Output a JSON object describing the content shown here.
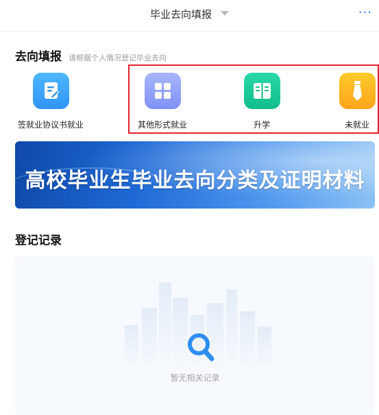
{
  "header": {
    "title": "毕业去向填报",
    "more": "···"
  },
  "section": {
    "title": "去向填报",
    "hint": "请根据个人情况登记毕业去向"
  },
  "categories": [
    {
      "label": "签就业协议书就业",
      "icon": "contract-edit-icon"
    },
    {
      "label": "其他形式就业",
      "icon": "grid-icon"
    },
    {
      "label": "升学",
      "icon": "book-icon"
    },
    {
      "label": "未就业",
      "icon": "tie-icon"
    }
  ],
  "banner": {
    "text": "高校毕业生毕业去向分类及证明材料"
  },
  "records": {
    "title": "登记记录",
    "empty_text": "暂无相关记录"
  },
  "colors": {
    "accent": "#1e7bf2",
    "highlight": "#e0242b"
  }
}
